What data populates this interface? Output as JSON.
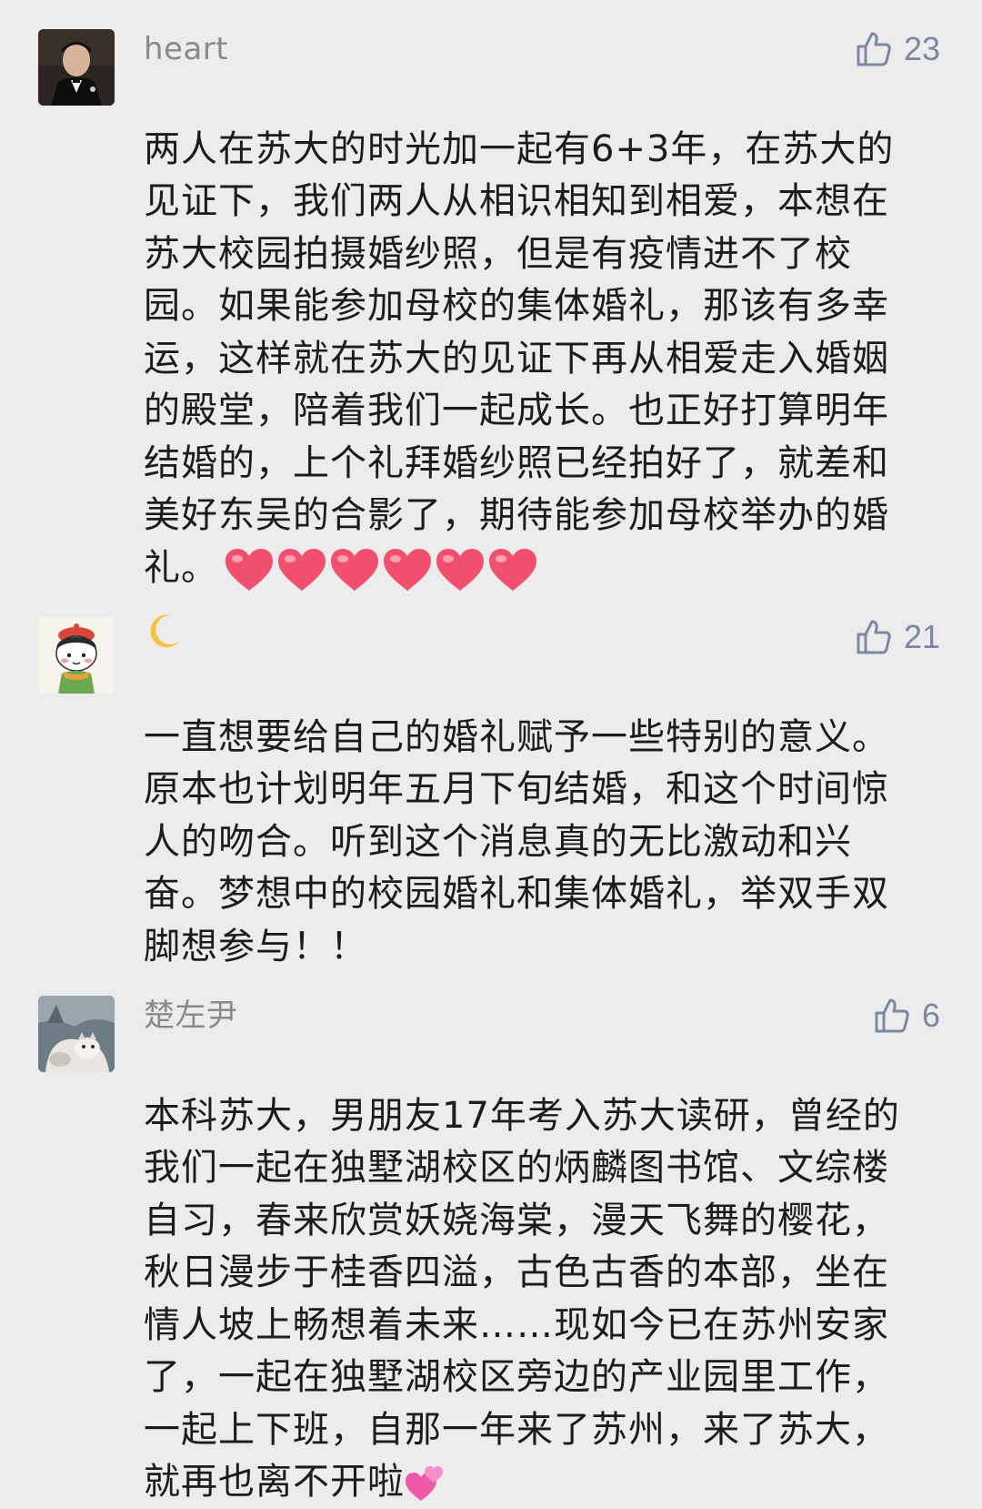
{
  "comments": [
    {
      "name": "heart",
      "likes": "23",
      "text": "两人在苏大的时光加一起有6+3年，在苏大的\n见证下，我们两人从相识相知到相爱，本想在\n苏大校园拍摄婚纱照，但是有疫情进不了校\n园。如果能参加母校的集体婚礼，那该有多幸\n运，这样就在苏大的见证下再从相爱走入婚姻\n的殿堂，陪着我们一起成长。也正好打算明年\n结婚的，上个礼拜婚纱照已经拍好了，就差和\n美好东吴的合影了，期待能参加母校举办的婚\n礼。",
      "emoji": "heart-icon x6"
    },
    {
      "name": "🌙",
      "likes": "21",
      "text": "一直想要给自己的婚礼赋予一些特别的意义。\n原本也计划明年五月下旬结婚，和这个时间惊\n人的吻合。听到这个消息真的无比激动和兴\n奋。梦想中的校园婚礼和集体婚礼，举双手双\n脚想参与！！"
    },
    {
      "name": "楚左尹",
      "likes": "6",
      "text": "本科苏大，男朋友17年考入苏大读研，曾经的\n我们一起在独墅湖校区的炳麟图书馆、文综楼\n自习，春来欣赏妖娆海棠，漫天飞舞的樱花，\n秋日漫步于桂香四溢，古色古香的本部，坐在\n情人坡上畅想着未来……现如今已在苏州安家\n了，一起在独墅湖校区旁边的产业园里工作，\n一起上下班，自那一年来了苏州，来了苏大，\n就再也离不开啦",
      "emoji": "sparkling-heart-icon"
    }
  ],
  "colors": {
    "background": "#ececec",
    "name_text": "#8a8a8a",
    "likes": "#7b87a3",
    "body_text": "#1c1c1c",
    "heart": "#f0506e"
  }
}
